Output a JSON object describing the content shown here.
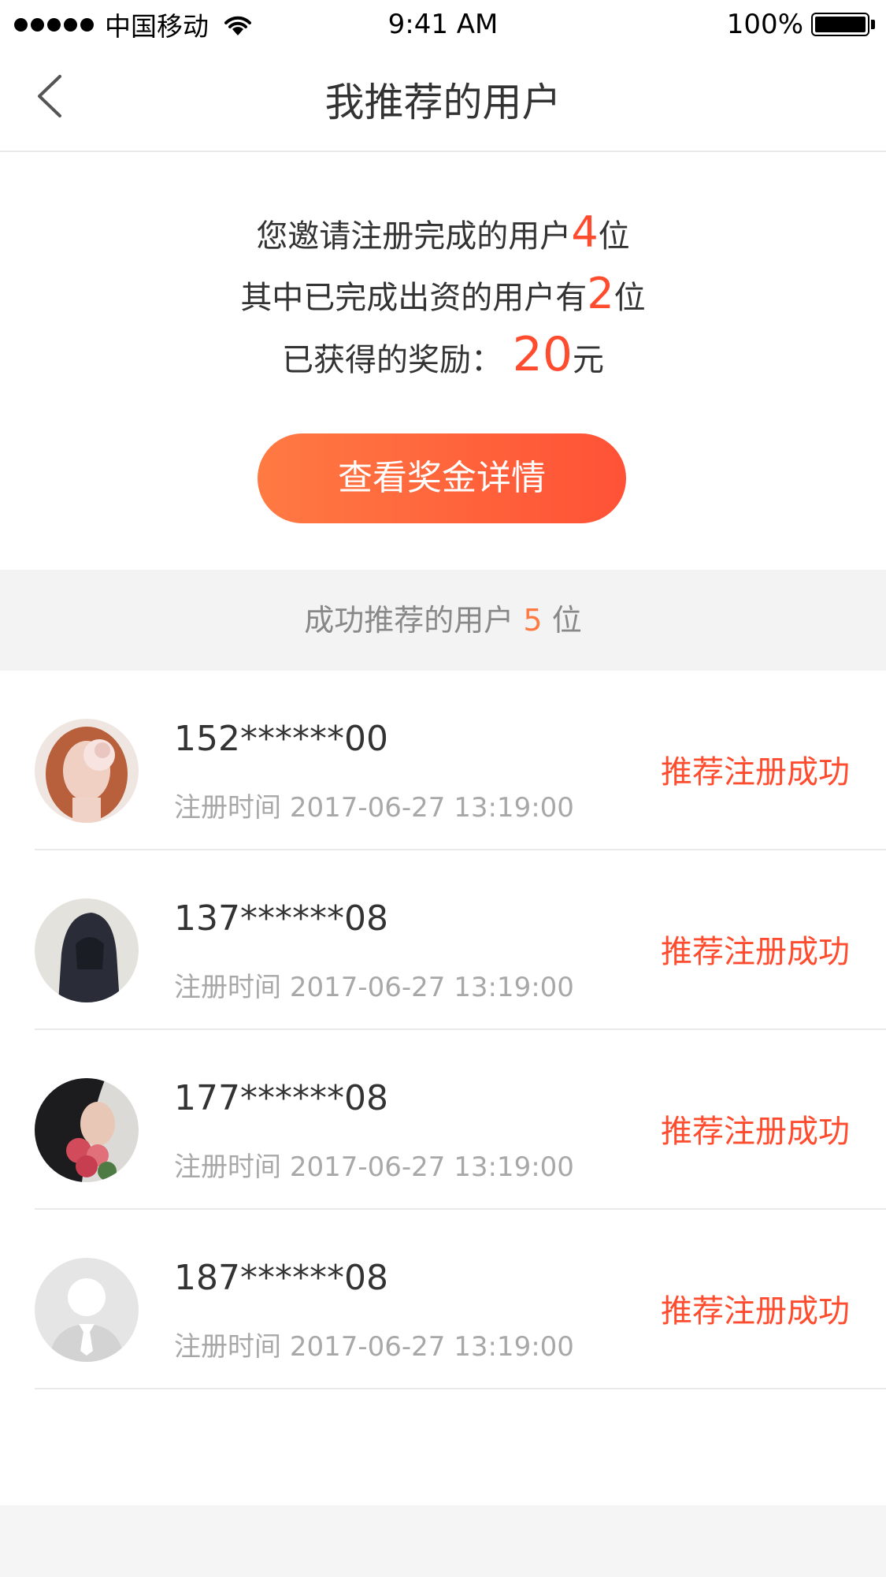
{
  "status_bar": {
    "carrier": "中国移动",
    "time": "9:41 AM",
    "battery": "100%"
  },
  "nav": {
    "title": "我推荐的用户"
  },
  "summary": {
    "line1_prefix": "您邀请注册完成的用户",
    "line1_count": "4",
    "line1_suffix": "位",
    "line2_prefix": "其中已完成出资的用户有",
    "line2_count": "2",
    "line2_suffix": "位",
    "line3_prefix": "已获得的奖励：",
    "line3_amount": "20",
    "line3_suffix": "元",
    "button_label": "查看奖金详情"
  },
  "section": {
    "label_prefix": "成功推荐的用户",
    "count": "5",
    "label_suffix": "位"
  },
  "users": [
    {
      "phone": "152******00",
      "reg_label": "注册时间",
      "reg_time": "2017-06-27 13:19:00",
      "status": "推荐注册成功",
      "avatar": "photo-avatar"
    },
    {
      "phone": "137******08",
      "reg_label": "注册时间",
      "reg_time": "2017-06-27 13:19:00",
      "status": "推荐注册成功",
      "avatar": "photo-avatar"
    },
    {
      "phone": "177******08",
      "reg_label": "注册时间",
      "reg_time": "2017-06-27 13:19:00",
      "status": "推荐注册成功",
      "avatar": "photo-avatar"
    },
    {
      "phone": "187******08",
      "reg_label": "注册时间",
      "reg_time": "2017-06-27 13:19:00",
      "status": "推荐注册成功",
      "avatar": "default-avatar-icon"
    }
  ],
  "colors": {
    "accent": "#ff4c2f",
    "button_gradient_start": "#ff7a43",
    "button_gradient_end": "#ff5236",
    "section_bg": "#f3f3f3"
  }
}
